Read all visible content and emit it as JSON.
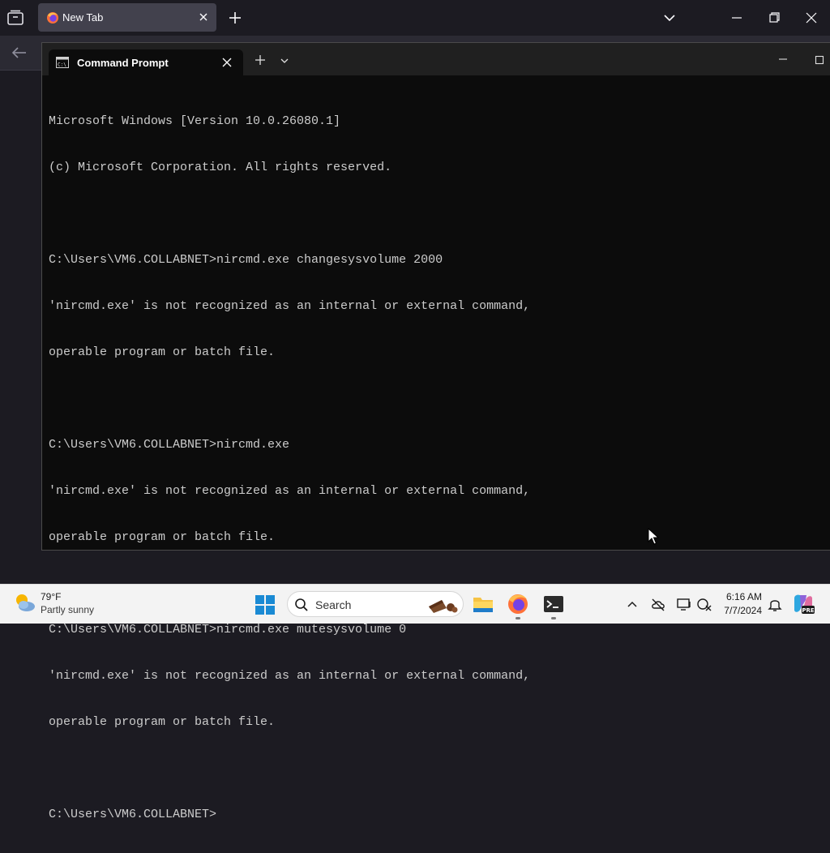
{
  "browser": {
    "tab_title": "New Tab"
  },
  "terminal": {
    "tab_title": "Command Prompt",
    "lines": [
      "Microsoft Windows [Version 10.0.26080.1]",
      "(c) Microsoft Corporation. All rights reserved.",
      "",
      "C:\\Users\\VM6.COLLABNET>nircmd.exe changesysvolume 2000",
      "'nircmd.exe' is not recognized as an internal or external command,",
      "operable program or batch file.",
      "",
      "C:\\Users\\VM6.COLLABNET>nircmd.exe",
      "'nircmd.exe' is not recognized as an internal or external command,",
      "operable program or batch file.",
      "",
      "C:\\Users\\VM6.COLLABNET>nircmd.exe mutesysvolume 0",
      "'nircmd.exe' is not recognized as an internal or external command,",
      "operable program or batch file.",
      "",
      "C:\\Users\\VM6.COLLABNET>"
    ]
  },
  "taskbar": {
    "weather_temp": "79°F",
    "weather_desc": "Partly sunny",
    "search_label": "Search",
    "time": "6:16 AM",
    "date": "7/7/2024",
    "copilot_badge": "PRE"
  },
  "icons": {
    "browser": [
      "firefox-icon",
      "close-icon",
      "plus-icon",
      "chevron-down-icon",
      "minimize-icon",
      "restore-icon",
      "back-arrow-icon"
    ],
    "terminal": [
      "terminal-icon",
      "close-icon",
      "plus-icon",
      "chevron-down-icon",
      "minimize-icon",
      "maximize-icon"
    ],
    "taskbar": [
      "weather-icon",
      "windows-start-icon",
      "search-icon",
      "file-explorer-icon",
      "firefox-icon",
      "terminal-icon",
      "chevron-up-icon",
      "onedrive-icon",
      "display-icon",
      "network-icon",
      "bell-icon",
      "copilot-icon"
    ]
  },
  "colors": {
    "terminal_bg": "#0c0c0c",
    "terminal_text": "#cccccc",
    "taskbar_bg": "#f3f3f3"
  }
}
